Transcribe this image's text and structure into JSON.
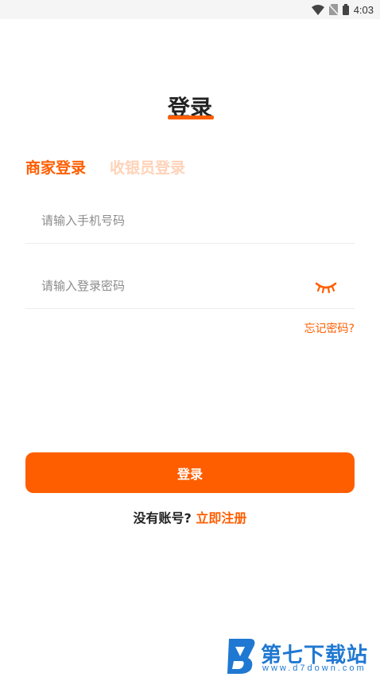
{
  "status_bar": {
    "time": "4:03",
    "icons": [
      "wifi-icon",
      "no-sim-icon",
      "battery-icon"
    ]
  },
  "page": {
    "title": "登录"
  },
  "tabs": [
    {
      "label": "商家登录",
      "active": true
    },
    {
      "label": "收银员登录",
      "active": false
    }
  ],
  "form": {
    "phone_placeholder": "请输入手机号码",
    "phone_value": "",
    "password_placeholder": "请输入登录密码",
    "password_value": "",
    "password_toggle_icon": "eye-closed-icon",
    "forgot_password": "忘记密码?"
  },
  "actions": {
    "login_label": "登录",
    "register_prompt": "没有账号?",
    "register_link": "立即注册"
  },
  "watermark": {
    "name": "第七下载站",
    "url": "www.d7down.com"
  },
  "colors": {
    "accent": "#ff5e00",
    "inactive_tab": "#ffd2b8",
    "watermark": "#1f78d1"
  }
}
